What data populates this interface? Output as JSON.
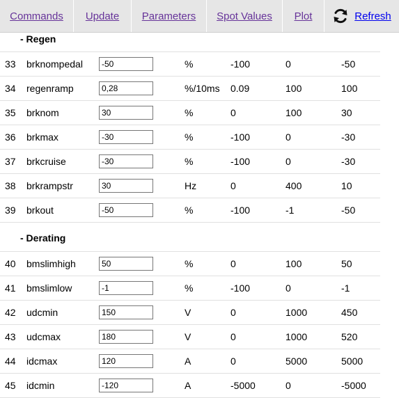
{
  "nav": {
    "commands": "Commands",
    "update": "Update",
    "parameters": "Parameters",
    "spot_values": "Spot Values",
    "plot": "Plot",
    "refresh": "Refresh"
  },
  "sections": [
    {
      "title": "- Regen",
      "rows": [
        {
          "num": "33",
          "name": "brknompedal",
          "value": "-50",
          "unit": "%",
          "min": "-100",
          "max": "0",
          "default": "-50"
        },
        {
          "num": "34",
          "name": "regenramp",
          "value": "0,28",
          "unit": "%/10ms",
          "min": "0.09",
          "max": "100",
          "default": "100"
        },
        {
          "num": "35",
          "name": "brknom",
          "value": "30",
          "unit": "%",
          "min": "0",
          "max": "100",
          "default": "30"
        },
        {
          "num": "36",
          "name": "brkmax",
          "value": "-30",
          "unit": "%",
          "min": "-100",
          "max": "0",
          "default": "-30"
        },
        {
          "num": "37",
          "name": "brkcruise",
          "value": "-30",
          "unit": "%",
          "min": "-100",
          "max": "0",
          "default": "-30"
        },
        {
          "num": "38",
          "name": "brkrampstr",
          "value": "30",
          "unit": "Hz",
          "min": "0",
          "max": "400",
          "default": "10"
        },
        {
          "num": "39",
          "name": "brkout",
          "value": "-50",
          "unit": "%",
          "min": "-100",
          "max": "-1",
          "default": "-50"
        }
      ]
    },
    {
      "title": "- Derating",
      "rows": [
        {
          "num": "40",
          "name": "bmslimhigh",
          "value": "50",
          "unit": "%",
          "min": "0",
          "max": "100",
          "default": "50"
        },
        {
          "num": "41",
          "name": "bmslimlow",
          "value": "-1",
          "unit": "%",
          "min": "-100",
          "max": "0",
          "default": "-1"
        },
        {
          "num": "42",
          "name": "udcmin",
          "value": "150",
          "unit": "V",
          "min": "0",
          "max": "1000",
          "default": "450"
        },
        {
          "num": "43",
          "name": "udcmax",
          "value": "180",
          "unit": "V",
          "min": "0",
          "max": "1000",
          "default": "520"
        },
        {
          "num": "44",
          "name": "idcmax",
          "value": "120",
          "unit": "A",
          "min": "0",
          "max": "5000",
          "default": "5000"
        },
        {
          "num": "45",
          "name": "idcmin",
          "value": "-120",
          "unit": "A",
          "min": "-5000",
          "max": "0",
          "default": "-5000"
        }
      ]
    }
  ]
}
